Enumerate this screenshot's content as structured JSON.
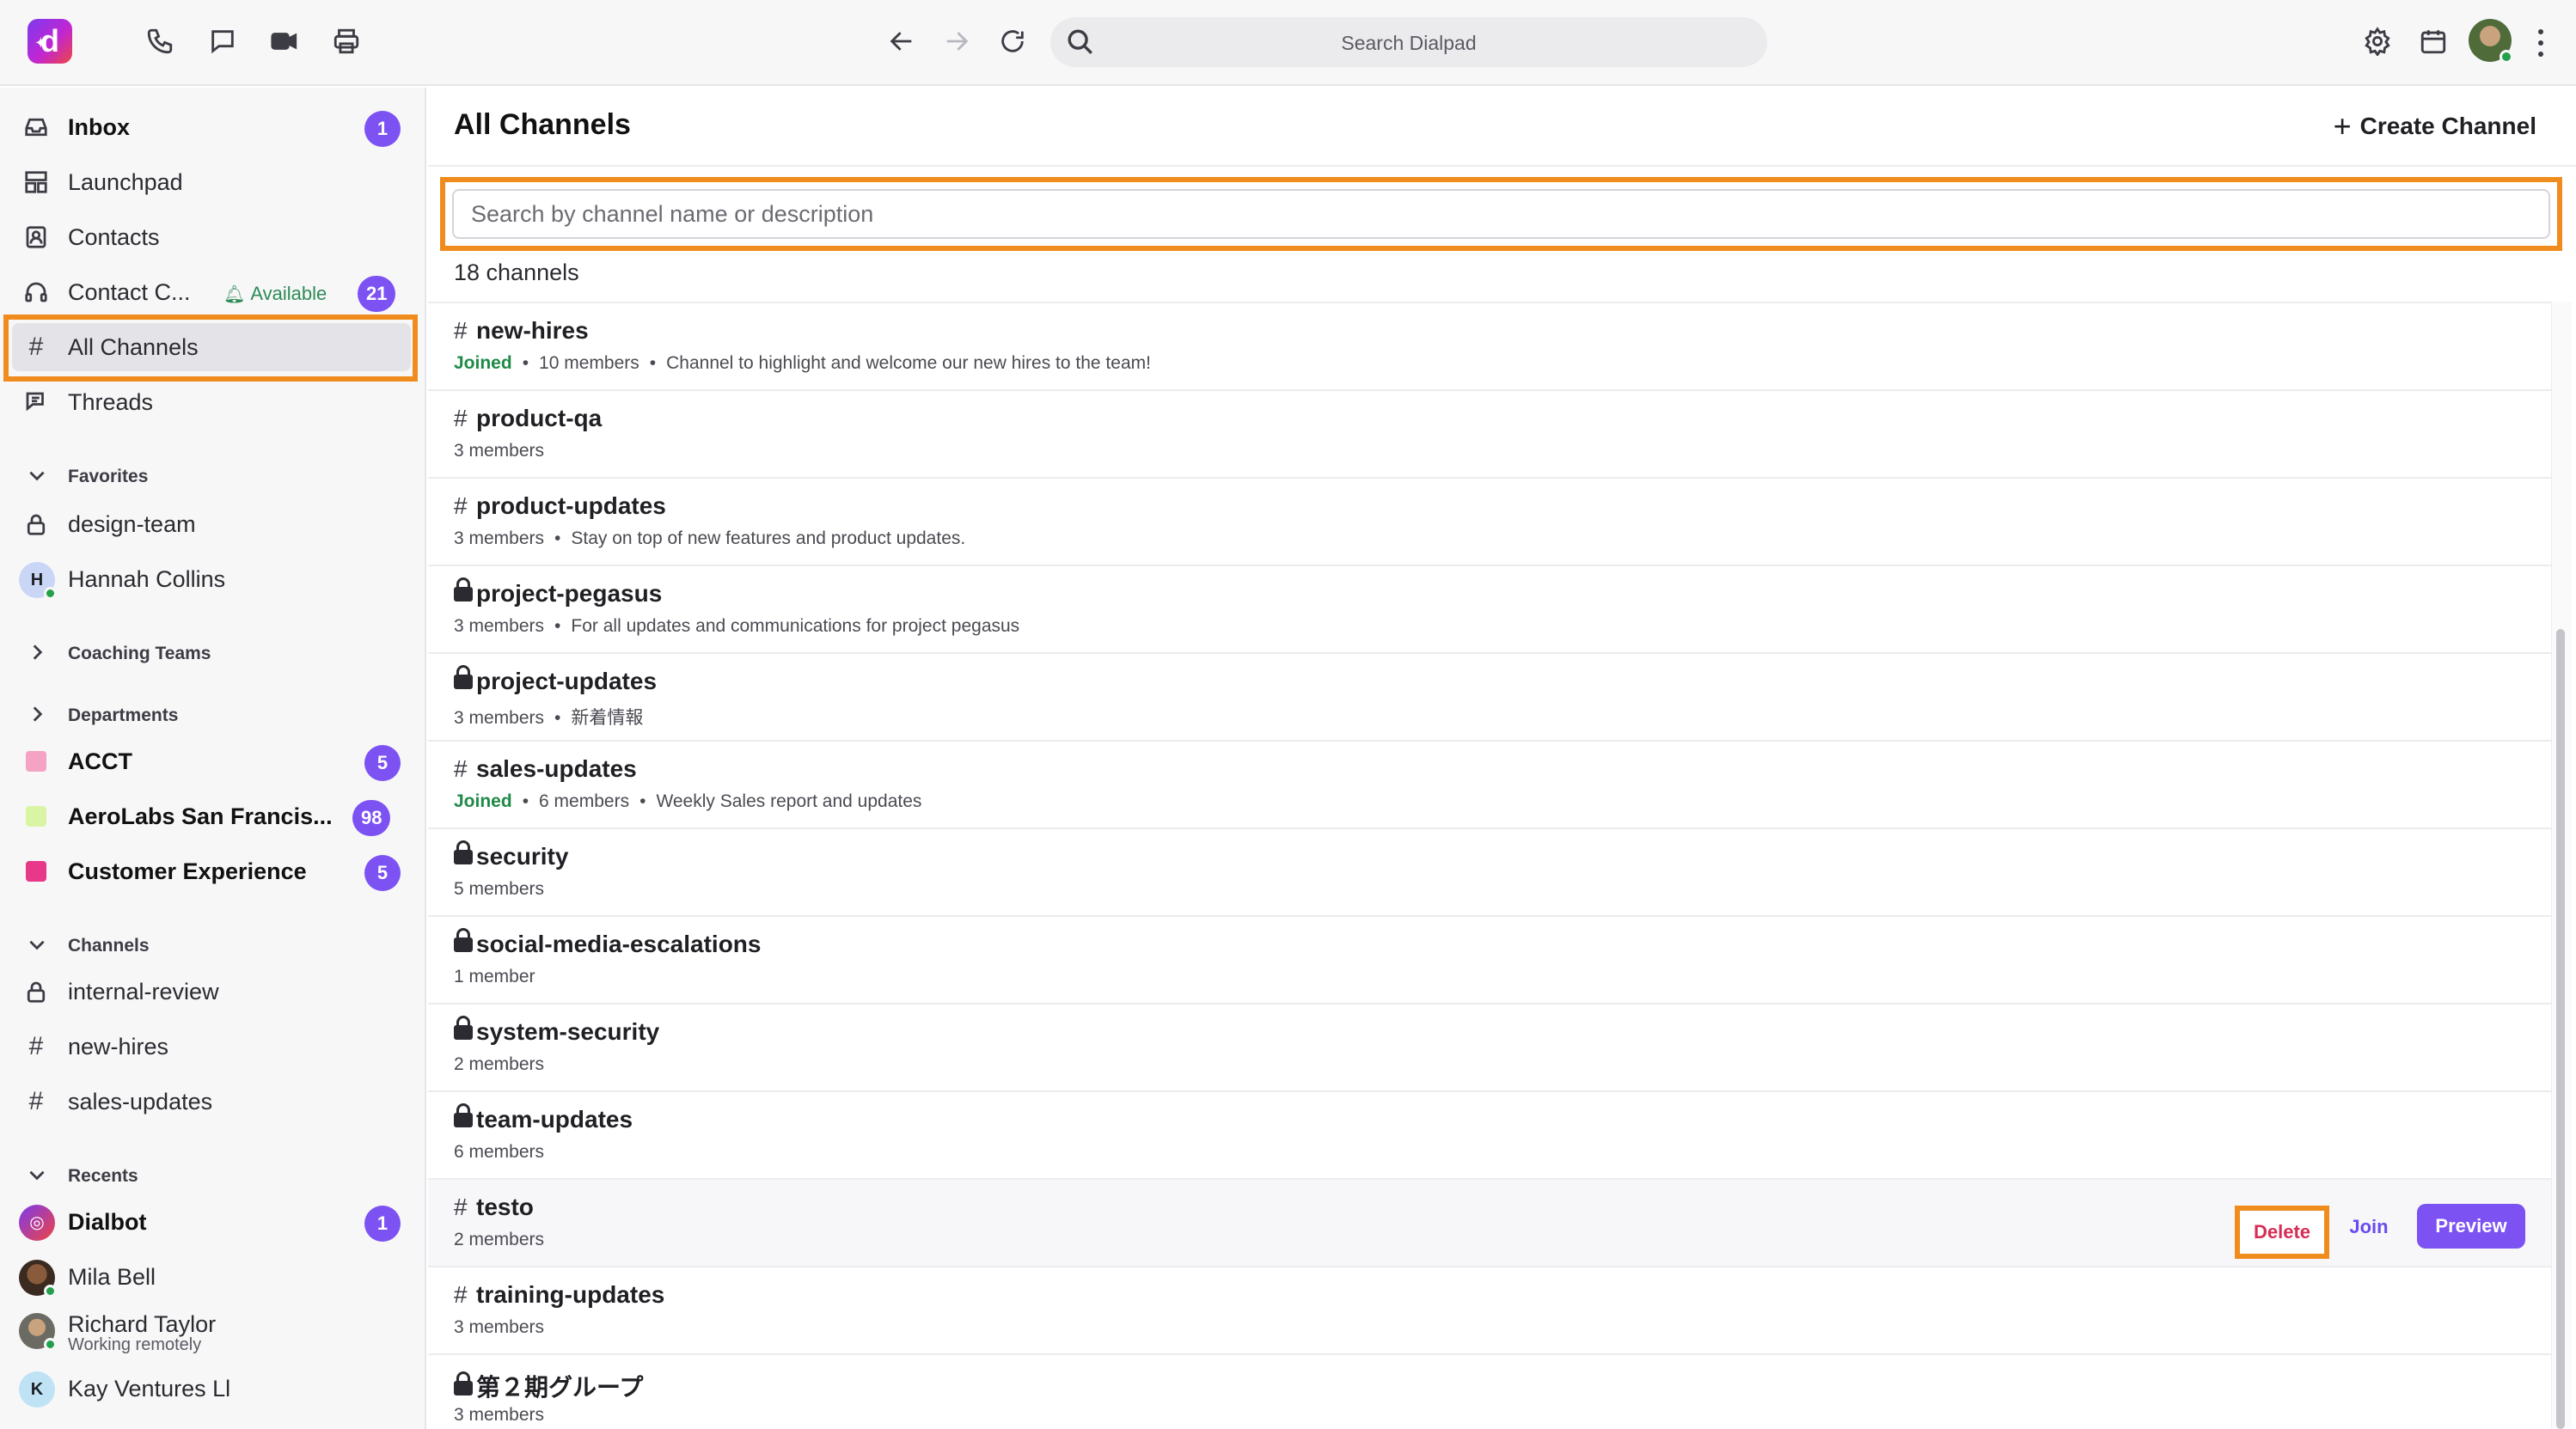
{
  "topbar": {
    "logo_letter": "d",
    "search_placeholder": "Search Dialpad"
  },
  "sidebar": {
    "nav": [
      {
        "label": "Inbox",
        "badge": "1"
      },
      {
        "label": "Launchpad"
      },
      {
        "label": "Contacts"
      },
      {
        "label": "Contact C...",
        "status": "Available",
        "badge": "21"
      },
      {
        "label": "All Channels"
      },
      {
        "label": "Threads"
      }
    ],
    "favorites": {
      "title": "Favorites",
      "items": [
        {
          "label": "design-team"
        },
        {
          "label": "Hannah Collins",
          "initial": "H"
        }
      ]
    },
    "coaching_title": "Coaching Teams",
    "departments": {
      "title": "Departments",
      "items": [
        {
          "label": "ACCT",
          "badge": "5",
          "color": "#f4a3c4"
        },
        {
          "label": "AeroLabs San Francis...",
          "badge": "98",
          "color": "#d9f5a4"
        },
        {
          "label": "Customer Experience",
          "badge": "5",
          "color": "#e8388a"
        }
      ]
    },
    "channels": {
      "title": "Channels",
      "items": [
        {
          "label": "internal-review"
        },
        {
          "label": "new-hires"
        },
        {
          "label": "sales-updates"
        }
      ]
    },
    "recents": {
      "title": "Recents",
      "items": [
        {
          "label": "Dialbot",
          "badge": "1"
        },
        {
          "label": "Mila Bell"
        },
        {
          "label": "Richard Taylor",
          "sub": "Working remotely"
        },
        {
          "label": "Kay Ventures Ll",
          "initial": "K"
        }
      ]
    }
  },
  "main": {
    "title": "All Channels",
    "create_label": "Create Channel",
    "search_placeholder": "Search by channel name or description",
    "count_label": "18 channels",
    "actions": {
      "delete": "Delete",
      "join": "Join",
      "preview": "Preview"
    },
    "channels": [
      {
        "name": "new-hires",
        "private": false,
        "joined": "Joined",
        "members": "10 members",
        "description": "Channel to highlight and welcome our new hires to the team!"
      },
      {
        "name": "product-qa",
        "private": false,
        "members": "3 members"
      },
      {
        "name": "product-updates",
        "private": false,
        "members": "3 members",
        "description": "Stay on top of new features and product updates."
      },
      {
        "name": "project-pegasus",
        "private": true,
        "members": "3 members",
        "description": "For all updates and communications for project pegasus"
      },
      {
        "name": "project-updates",
        "private": true,
        "members": "3 members",
        "description": "新着情報"
      },
      {
        "name": "sales-updates",
        "private": false,
        "joined": "Joined",
        "members": "6 members",
        "description": "Weekly Sales report and updates"
      },
      {
        "name": "security",
        "private": true,
        "members": "5 members"
      },
      {
        "name": "social-media-escalations",
        "private": true,
        "members": "1 member"
      },
      {
        "name": "system-security",
        "private": true,
        "members": "2 members"
      },
      {
        "name": "team-updates",
        "private": true,
        "members": "6 members"
      },
      {
        "name": "testo",
        "private": false,
        "members": "2 members"
      },
      {
        "name": "training-updates",
        "private": false,
        "members": "3 members"
      },
      {
        "name": "第２期グループ",
        "private": true,
        "members": "3 members"
      }
    ]
  },
  "colors": {
    "accent": "#7c52f3",
    "highlight": "#f08c1e",
    "joined": "#1e8a47",
    "delete": "#d62d55"
  }
}
